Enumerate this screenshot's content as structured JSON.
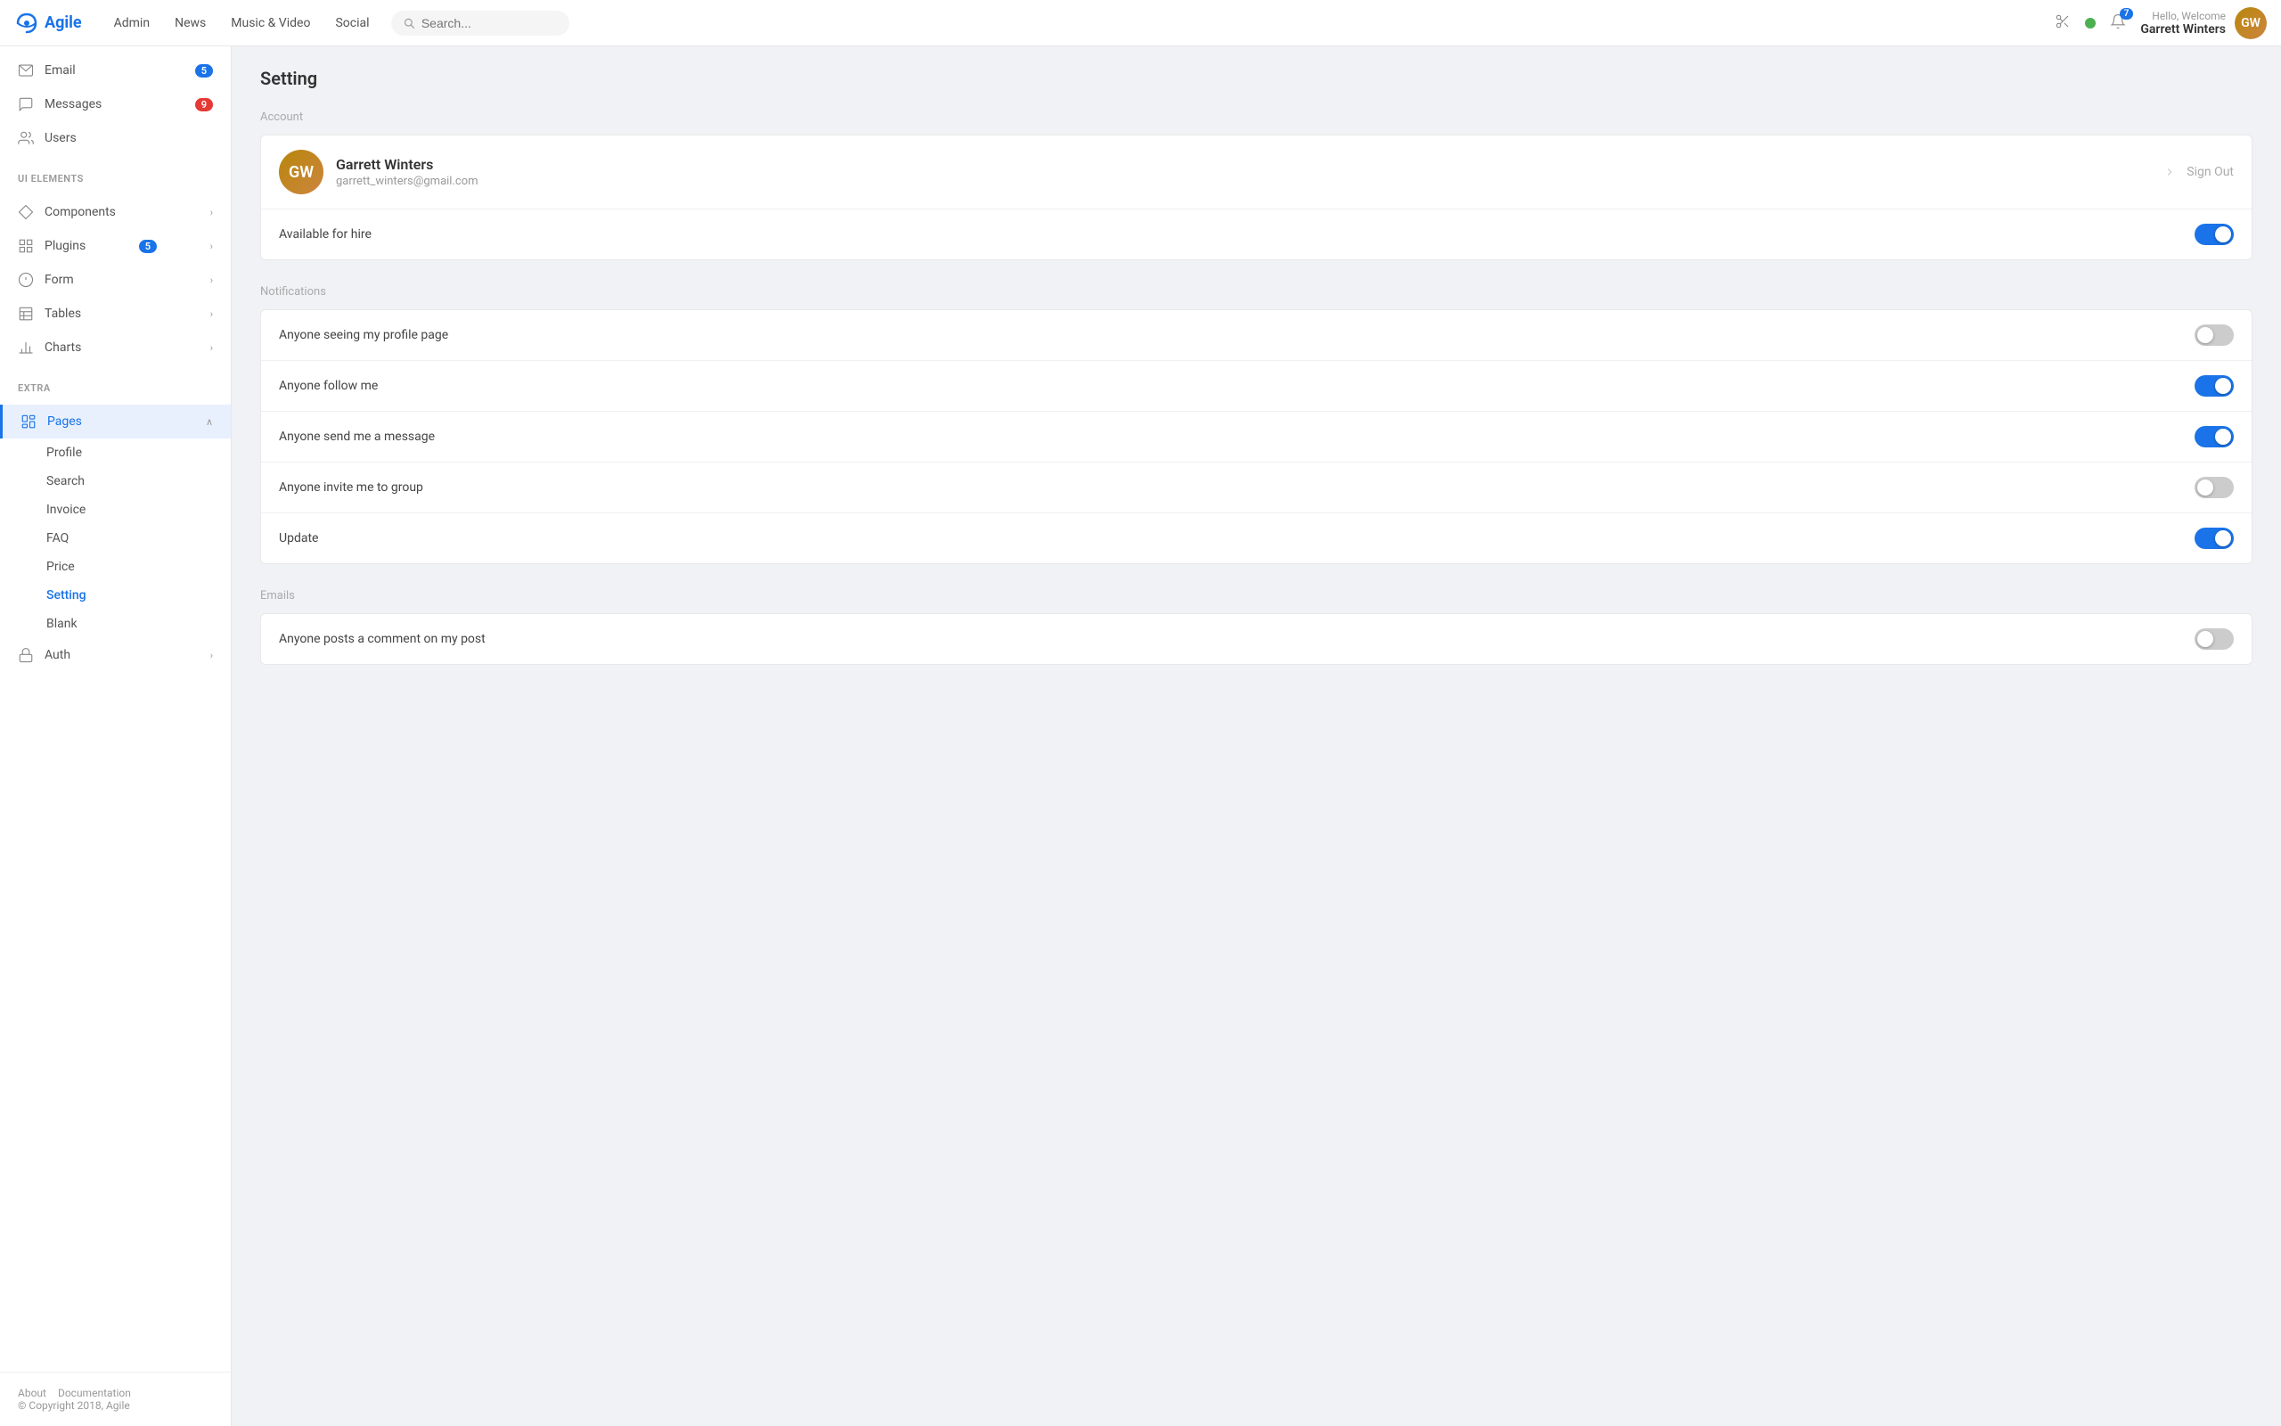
{
  "app": {
    "logo_text": "Agile",
    "nav_links": [
      "Admin",
      "News",
      "Music & Video",
      "Social"
    ],
    "search_placeholder": "Search...",
    "notification_badge": "7",
    "user_welcome": "Hello, Welcome",
    "user_name": "Garrett Winters",
    "user_initials": "GW"
  },
  "sidebar": {
    "items": [
      {
        "label": "Email",
        "badge": "5",
        "badge_type": "blue",
        "icon": "email"
      },
      {
        "label": "Messages",
        "badge": "9",
        "badge_type": "red",
        "icon": "message"
      },
      {
        "label": "Users",
        "icon": "users"
      }
    ],
    "section_ui": "UI elements",
    "ui_items": [
      {
        "label": "Components",
        "has_chevron": true,
        "icon": "diamond"
      },
      {
        "label": "Plugins",
        "badge": "5",
        "has_chevron": true,
        "icon": "grid"
      },
      {
        "label": "Form",
        "has_chevron": true,
        "icon": "form"
      },
      {
        "label": "Tables",
        "has_chevron": true,
        "icon": "table"
      },
      {
        "label": "Charts",
        "has_chevron": true,
        "icon": "chart"
      }
    ],
    "section_extra": "Extra",
    "extra_items": [
      {
        "label": "Pages",
        "active": true,
        "expanded": true,
        "icon": "pages"
      },
      {
        "label": "Auth",
        "has_chevron": true,
        "icon": "auth"
      }
    ],
    "pages_sub_items": [
      {
        "label": "Profile",
        "active": false
      },
      {
        "label": "Search",
        "active": false
      },
      {
        "label": "Invoice",
        "active": false
      },
      {
        "label": "FAQ",
        "active": false
      },
      {
        "label": "Price",
        "active": false
      },
      {
        "label": "Setting",
        "active": true
      },
      {
        "label": "Blank",
        "active": false
      }
    ],
    "footer_links": [
      "About",
      "Documentation"
    ],
    "footer_copy": "© Copyright 2018, Agile"
  },
  "main": {
    "page_title": "Setting",
    "sections": [
      {
        "label": "Account",
        "items": [
          {
            "type": "profile",
            "name": "Garrett Winters",
            "email": "garrett_winters@gmail.com",
            "show_signout": true,
            "signout_label": "Sign Out"
          },
          {
            "type": "toggle",
            "label": "Available for hire",
            "checked": true
          }
        ]
      },
      {
        "label": "Notifications",
        "items": [
          {
            "type": "toggle",
            "label": "Anyone seeing my profile page",
            "checked": false
          },
          {
            "type": "toggle",
            "label": "Anyone follow me",
            "checked": true
          },
          {
            "type": "toggle",
            "label": "Anyone send me a message",
            "checked": true
          },
          {
            "type": "toggle",
            "label": "Anyone invite me to group",
            "checked": false
          },
          {
            "type": "toggle",
            "label": "Update",
            "checked": true
          }
        ]
      },
      {
        "label": "Emails",
        "items": [
          {
            "type": "toggle",
            "label": "Anyone posts a comment on my post",
            "checked": false
          }
        ]
      }
    ]
  }
}
